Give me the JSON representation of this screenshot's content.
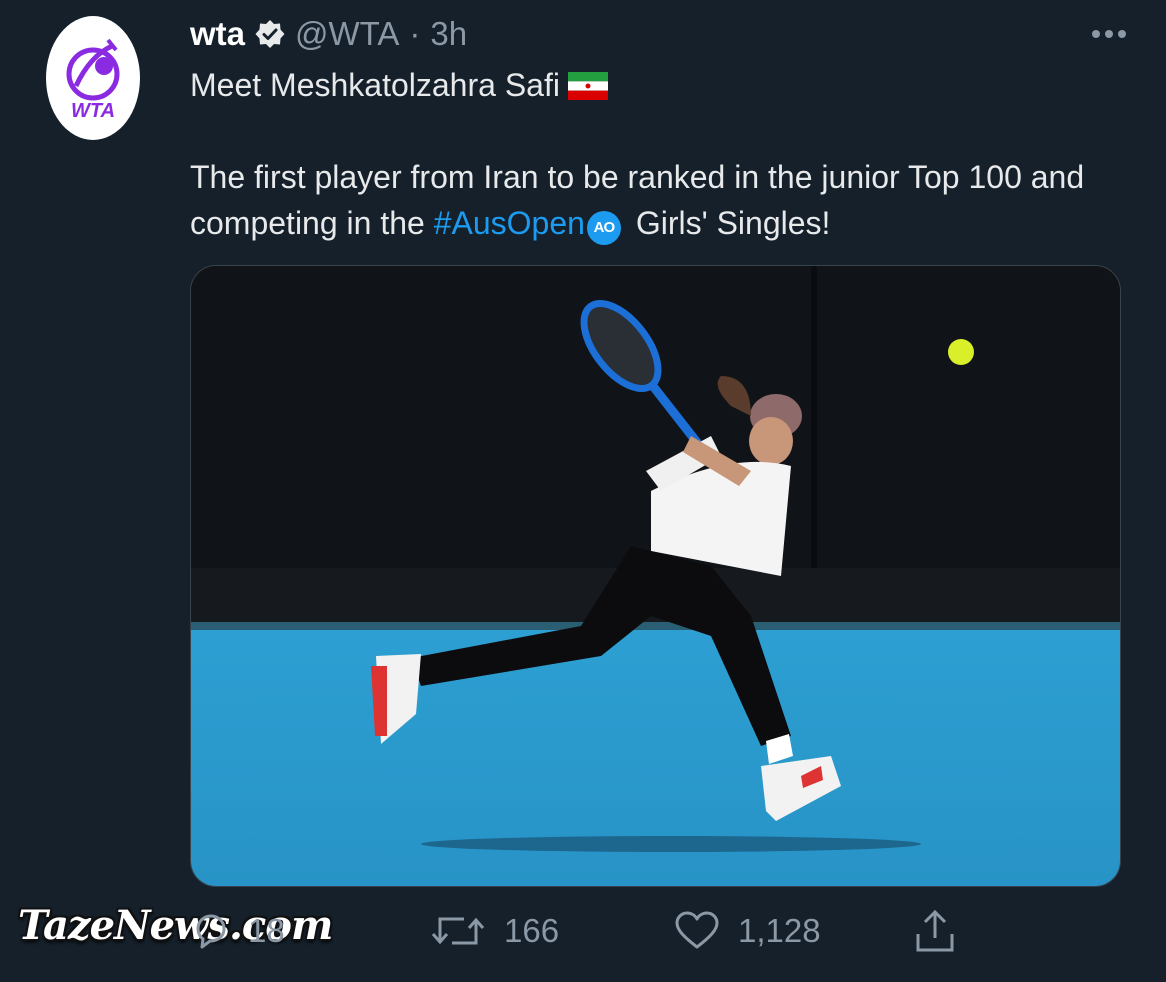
{
  "tweet": {
    "display_name": "wta",
    "handle": "@WTA",
    "separator": "·",
    "time": "3h",
    "avatar_logo_text": "WTA",
    "text_line1": "Meet Meshkatolzahra Safi",
    "text_part1": "The first player from Iran to be ranked in the junior Top 100 and competing in the ",
    "hashtag": "#AusOpen",
    "hashtag_emoji": "AO",
    "text_part2": " Girls' Singles!"
  },
  "icons": {
    "verified": "verified-badge-icon",
    "more": "more-icon",
    "flag": "iran-flag-emoji",
    "reply": "reply-icon",
    "retweet": "retweet-icon",
    "like": "heart-icon",
    "share": "share-icon"
  },
  "actions": {
    "reply_count": "18",
    "retweet_count": "166",
    "like_count": "1,128"
  },
  "watermark": "TazeNews.com",
  "colors": {
    "background": "#15202b",
    "accent": "#1d9bf0",
    "muted": "#8b98a5",
    "brand_purple": "#8a2be2",
    "court_blue": "#2aa0d6"
  }
}
